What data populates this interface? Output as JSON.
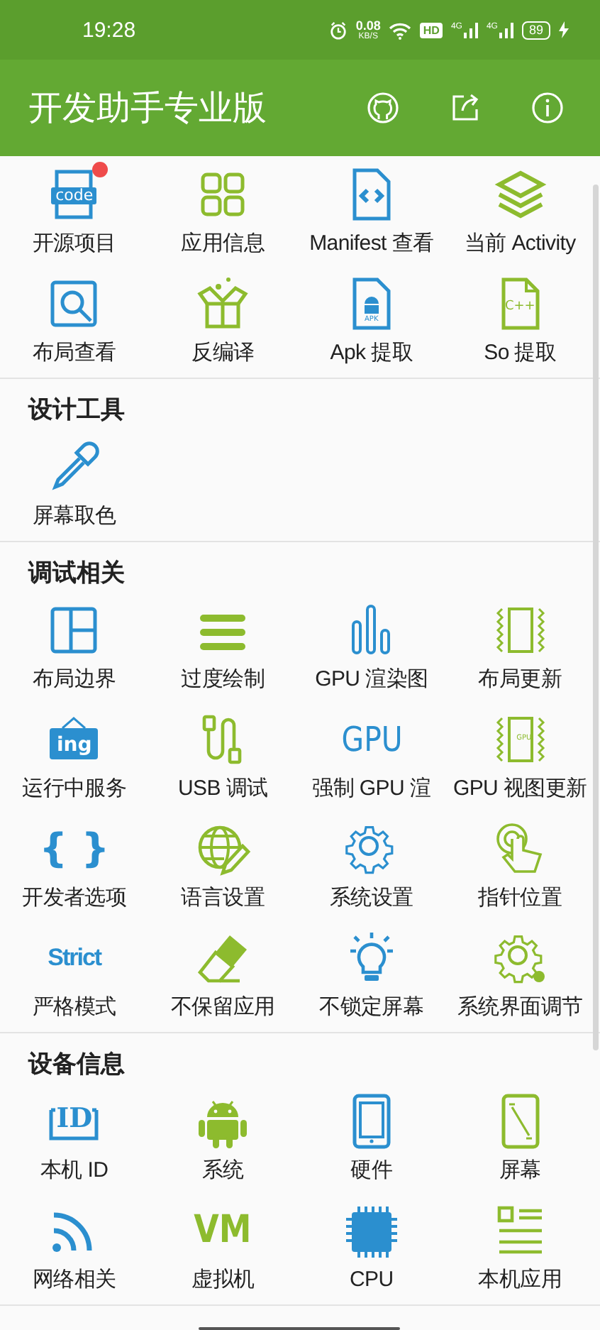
{
  "status_bar": {
    "time": "19:28",
    "speed": "0.08",
    "speed_unit": "KB/S",
    "hd_label": "HD",
    "sims": [
      {
        "label": "4G"
      },
      {
        "label": "4G"
      }
    ],
    "battery": "89"
  },
  "app_bar": {
    "title": "开发助手专业版"
  },
  "sections": [
    {
      "items": [
        {
          "label": "开源项目",
          "glyph": "code",
          "dot": true
        },
        {
          "label": "应用信息"
        },
        {
          "label": "Manifest 查看"
        },
        {
          "label": "当前 Activity"
        },
        {
          "label": "布局查看"
        },
        {
          "label": "反编译"
        },
        {
          "label": "Apk 提取",
          "glyph": "APK"
        },
        {
          "label": "So 提取",
          "glyph": "C++"
        }
      ]
    },
    {
      "title": "设计工具",
      "items": [
        {
          "label": "屏幕取色"
        }
      ]
    },
    {
      "title": "调试相关",
      "items": [
        {
          "label": "布局边界"
        },
        {
          "label": "过度绘制"
        },
        {
          "label": "GPU 渲染图"
        },
        {
          "label": "布局更新"
        },
        {
          "label": "运行中服务",
          "glyph": "ing"
        },
        {
          "label": "USB 调试"
        },
        {
          "label": "强制 GPU 渲",
          "glyph": "GPU"
        },
        {
          "label": "GPU 视图更新",
          "glyph": "GPU"
        },
        {
          "label": "开发者选项",
          "glyph": "{ }"
        },
        {
          "label": "语言设置"
        },
        {
          "label": "系统设置"
        },
        {
          "label": "指针位置"
        },
        {
          "label": "严格模式",
          "glyph": "Strict"
        },
        {
          "label": "不保留应用"
        },
        {
          "label": "不锁定屏幕"
        },
        {
          "label": "系统界面调节"
        }
      ]
    },
    {
      "title": "设备信息",
      "items": [
        {
          "label": "本机 ID",
          "glyph": "ID"
        },
        {
          "label": "系统"
        },
        {
          "label": "硬件"
        },
        {
          "label": "屏幕"
        },
        {
          "label": "网络相关"
        },
        {
          "label": "虚拟机",
          "glyph": "VM"
        },
        {
          "label": "CPU"
        },
        {
          "label": "本机应用"
        }
      ]
    }
  ]
}
